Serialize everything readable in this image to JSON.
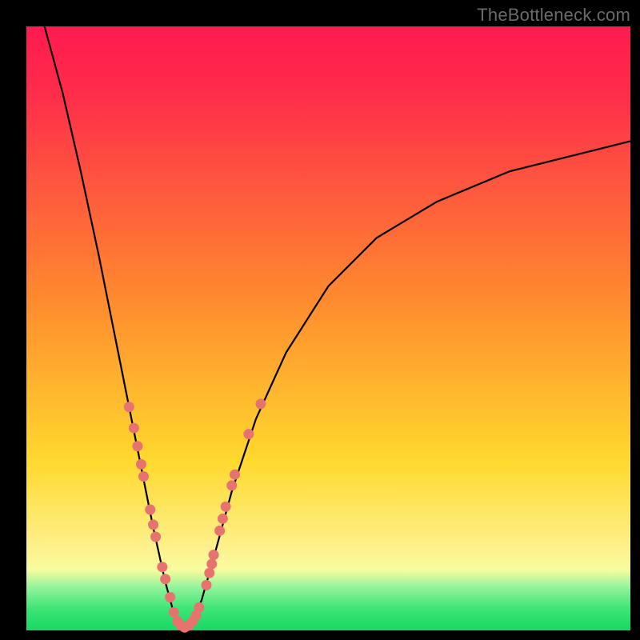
{
  "watermark": "TheBottleneck.com",
  "colors": {
    "top": "#ff1a4f",
    "red": "#ff2f4a",
    "orange": "#ff8a2e",
    "yellow": "#ffd92e",
    "paleyellow": "#fef08a",
    "paleyellow2": "#f8fc9e",
    "green1": "#8ff39a",
    "green2": "#3be574",
    "green3": "#17d864",
    "marker": "#e7736f"
  },
  "chart_data": {
    "type": "line",
    "title": "",
    "xlabel": "",
    "ylabel": "",
    "xlim": [
      0,
      100
    ],
    "ylim": [
      0,
      100
    ],
    "note": "Bottleneck-style V-curve. y≈0 at the optimum near x≈26; rises steeply toward 100 on the left edge and more gradually toward ~80 on the right edge. Values estimated from pixel positions.",
    "series": [
      {
        "name": "bottleneck-curve",
        "x": [
          3,
          6,
          9,
          12,
          15,
          17,
          19,
          21,
          23,
          24.5,
          26,
          27.5,
          29,
          31,
          34,
          38,
          43,
          50,
          58,
          68,
          80,
          92,
          100
        ],
        "y": [
          100,
          89,
          76,
          62,
          47,
          37,
          27,
          17,
          8,
          2.5,
          0,
          1.5,
          5,
          12,
          23,
          35,
          46,
          57,
          65,
          71,
          76,
          79,
          81
        ]
      }
    ],
    "markers": {
      "name": "sample-points",
      "note": "Salmon dots clustered along the lower part of the V, denser at the trough.",
      "points": [
        {
          "x": 17.0,
          "y": 37.0
        },
        {
          "x": 17.8,
          "y": 33.5
        },
        {
          "x": 18.4,
          "y": 30.5
        },
        {
          "x": 19.0,
          "y": 27.5
        },
        {
          "x": 19.4,
          "y": 25.5
        },
        {
          "x": 20.5,
          "y": 20.0
        },
        {
          "x": 21.0,
          "y": 17.5
        },
        {
          "x": 21.4,
          "y": 15.5
        },
        {
          "x": 22.5,
          "y": 10.5
        },
        {
          "x": 23.0,
          "y": 8.5
        },
        {
          "x": 23.8,
          "y": 5.5
        },
        {
          "x": 24.4,
          "y": 3.0
        },
        {
          "x": 25.0,
          "y": 1.5
        },
        {
          "x": 25.6,
          "y": 0.8
        },
        {
          "x": 26.2,
          "y": 0.5
        },
        {
          "x": 26.9,
          "y": 0.8
        },
        {
          "x": 27.5,
          "y": 1.5
        },
        {
          "x": 28.1,
          "y": 2.5
        },
        {
          "x": 28.6,
          "y": 3.8
        },
        {
          "x": 29.8,
          "y": 7.5
        },
        {
          "x": 30.3,
          "y": 9.5
        },
        {
          "x": 30.7,
          "y": 11.0
        },
        {
          "x": 31.0,
          "y": 12.5
        },
        {
          "x": 32.0,
          "y": 16.5
        },
        {
          "x": 32.5,
          "y": 18.5
        },
        {
          "x": 33.0,
          "y": 20.5
        },
        {
          "x": 34.0,
          "y": 24.0
        },
        {
          "x": 34.5,
          "y": 25.8
        },
        {
          "x": 36.8,
          "y": 32.5
        },
        {
          "x": 38.8,
          "y": 37.5
        }
      ]
    }
  }
}
